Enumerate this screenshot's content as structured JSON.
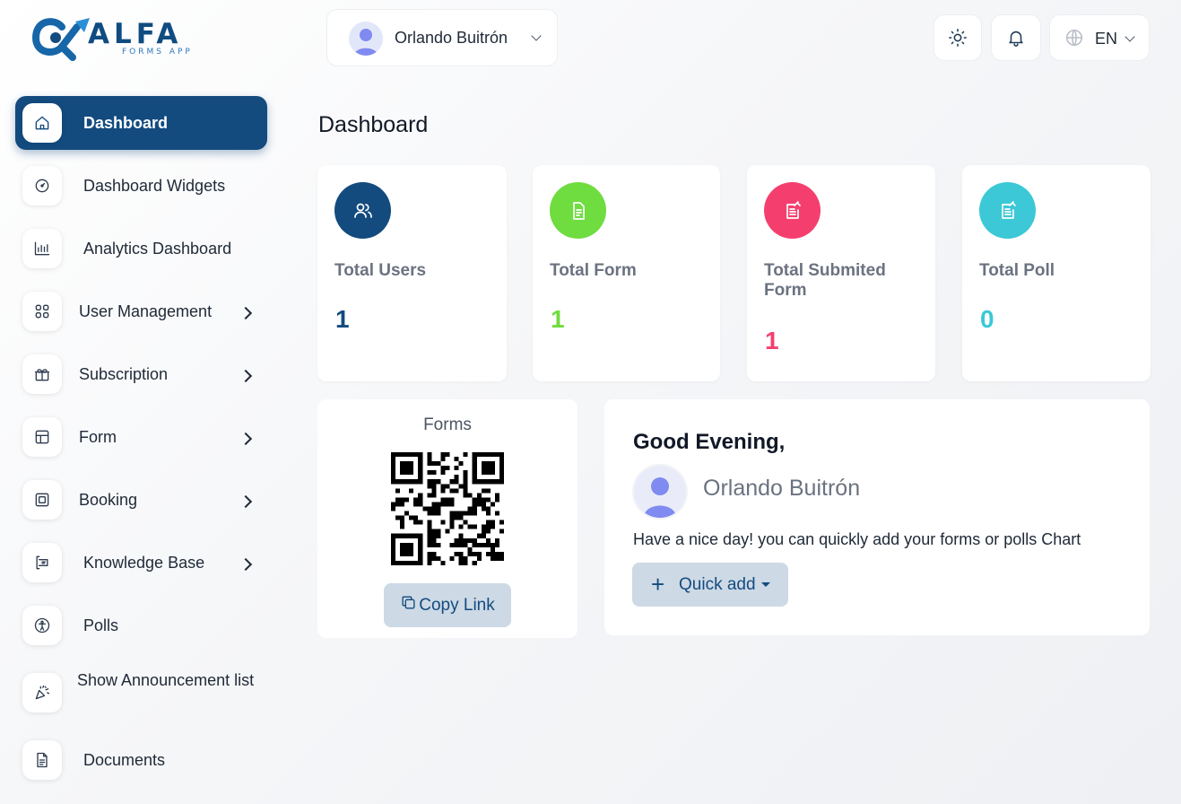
{
  "brand": {
    "name": "ALFA",
    "tagline": "FORMS APP",
    "primary_color": "#134b7f"
  },
  "header": {
    "user_name": "Orlando Buitrón",
    "theme_icon": "sun-icon",
    "notifications_icon": "bell-icon",
    "language": {
      "icon": "globe-icon",
      "value": "EN"
    }
  },
  "sidebar": {
    "items": [
      {
        "label": "Dashboard",
        "icon": "home-icon",
        "active": true
      },
      {
        "label": "Dashboard Widgets",
        "icon": "gauge-icon"
      },
      {
        "label": "Analytics Dashboard",
        "icon": "bar-chart-icon"
      },
      {
        "label": "User Management",
        "icon": "grid-icon",
        "has_submenu": true
      },
      {
        "label": "Subscription",
        "icon": "gift-icon",
        "has_submenu": true
      },
      {
        "label": "Form",
        "icon": "table-icon",
        "has_submenu": true
      },
      {
        "label": "Booking",
        "icon": "square-icon",
        "has_submenu": true
      },
      {
        "label": "Knowledge Base",
        "icon": "book-icon",
        "has_submenu": true
      },
      {
        "label": "Polls",
        "icon": "accessibility-icon"
      },
      {
        "label": "Show Announcement list",
        "icon": "confetti-icon"
      },
      {
        "label": "Documents",
        "icon": "document-icon"
      }
    ]
  },
  "main": {
    "title": "Dashboard",
    "stats": [
      {
        "label": "Total Users",
        "value": "1",
        "color": "#134b7f",
        "icon": "users-icon"
      },
      {
        "label": "Total Form",
        "value": "1",
        "color": "#6fdc3f",
        "icon": "file-text-icon"
      },
      {
        "label": "Total Submited Form",
        "value": "1",
        "color": "#f43f6e",
        "icon": "file-edit-icon"
      },
      {
        "label": "Total Poll",
        "value": "0",
        "color": "#3cc8d6",
        "icon": "poll-icon"
      }
    ],
    "forms_card": {
      "title": "Forms",
      "qr_icon": "qr-code-icon",
      "copy_label": "Copy Link"
    },
    "greeting": {
      "title": "Good Evening,",
      "user_name": "Orlando Buitrón",
      "message": "Have a nice day! you can quickly add your forms or polls Chart",
      "quick_add_label": "Quick add"
    }
  }
}
